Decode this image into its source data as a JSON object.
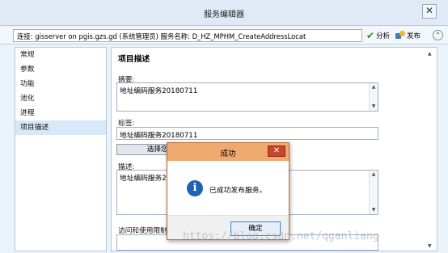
{
  "window": {
    "title": "服务编辑器",
    "close_glyph": "✕"
  },
  "connection": {
    "info": "连接: gisserver on pgis.gzs.gd (系统管理员)    服务名称: D_HZ_MPHM_CreateAddressLocat",
    "analyze_label": "分析",
    "publish_label": "发布",
    "collapse_glyph": "⌃"
  },
  "nav": {
    "items": [
      "常规",
      "参数",
      "功能",
      "池化",
      "进程",
      "项目描述"
    ],
    "active": "项目描述"
  },
  "panel": {
    "section_title": "项目描述",
    "summary_label": "摘要:",
    "summary_value": "地址编码服务20180711",
    "tags_label": "标签:",
    "tags_value": "地址编码服务20180711",
    "choose_button": "选择您的",
    "description_label": "描述:",
    "description_value": "地址编码服务20",
    "access_label": "访问和使用限制:"
  },
  "dialog": {
    "title": "成功",
    "message": "已成功发布服务。",
    "ok_label": "确定",
    "close_glyph": "✕",
    "info_glyph": "i"
  },
  "watermark": "https://blog.csdn.net/qganliang"
}
